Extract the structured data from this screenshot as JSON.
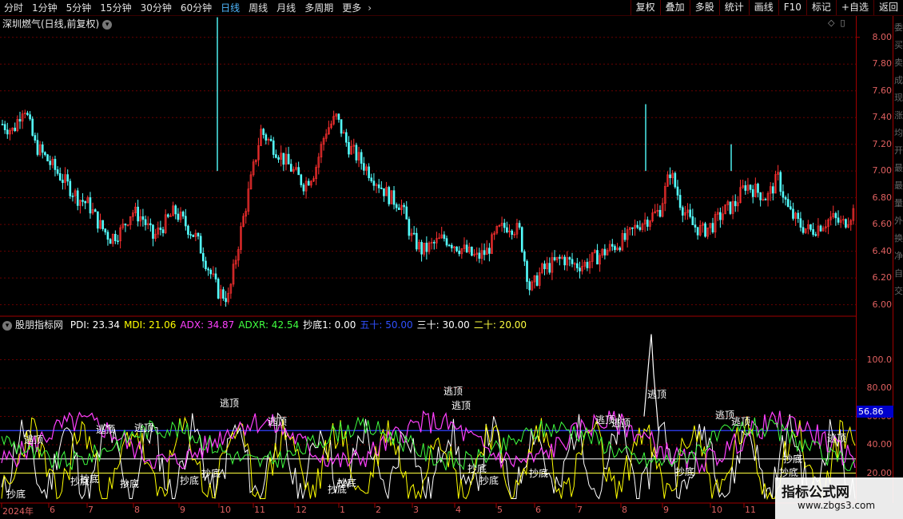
{
  "toolbar": {
    "periods": [
      "分时",
      "1分钟",
      "5分钟",
      "15分钟",
      "30分钟",
      "60分钟",
      "日线",
      "周线",
      "月线",
      "多周期",
      "更多"
    ],
    "active_period": "日线",
    "right_buttons": [
      "复权",
      "叠加",
      "多股",
      "统计",
      "画线",
      "F10",
      "标记",
      "+自选",
      "返回"
    ]
  },
  "price_panel": {
    "title": "深圳燃气(日线,前复权)",
    "y_ticks": [
      "8.00",
      "7.80",
      "7.60",
      "7.40",
      "7.20",
      "7.00",
      "6.80",
      "6.60",
      "6.40",
      "6.20",
      "6.00"
    ]
  },
  "indicator_panel": {
    "name": "股朋指标网",
    "values": [
      {
        "label": "PDI: 23.34",
        "color": "#ffffff"
      },
      {
        "label": "MDI: 21.06",
        "color": "#ffff00"
      },
      {
        "label": "ADX: 34.87",
        "color": "#ff40ff"
      },
      {
        "label": "ADXR: 42.54",
        "color": "#40ff40"
      },
      {
        "label": "抄底1: 0.00",
        "color": "#ffffff"
      },
      {
        "label": "五十: 50.00",
        "color": "#3050ff"
      },
      {
        "label": "三十: 30.00",
        "color": "#ffffff"
      },
      {
        "label": "二十: 20.00",
        "color": "#ffff40"
      }
    ],
    "y_ticks": [
      "100.0",
      "80.00",
      "60.00",
      "40.00",
      "20.00"
    ],
    "current_value": "56.86",
    "signal_escape": "逃顶",
    "signal_bottom": "抄底"
  },
  "x_axis": [
    "2024年",
    "6",
    "7",
    "8",
    "9",
    "10",
    "11",
    "12",
    "1",
    "2",
    "3",
    "4",
    "5",
    "6",
    "7",
    "8",
    "9",
    "10",
    "11"
  ],
  "side_strip": [
    "委",
    "买",
    "卖",
    "成",
    "现",
    "涨",
    "均",
    "开",
    "最",
    "最",
    "量",
    "外",
    "换",
    "净",
    "自",
    "交"
  ],
  "watermark": {
    "title": "指标公式网",
    "url": "www.zbgs3.com"
  },
  "chart_data": {
    "type": "candlestick",
    "title": "深圳燃气(日线,前复权)",
    "ylim": [
      5.95,
      8.1
    ],
    "x_month_labels": [
      "2024年",
      "6",
      "7",
      "8",
      "9",
      "10",
      "11",
      "12",
      "1",
      "2",
      "3",
      "4",
      "5",
      "6",
      "7",
      "8",
      "9",
      "10",
      "11"
    ],
    "close_series": [
      7.35,
      7.3,
      7.5,
      7.2,
      7.1,
      7.0,
      6.9,
      6.8,
      6.75,
      6.6,
      6.5,
      6.55,
      6.7,
      6.65,
      6.5,
      6.6,
      6.7,
      6.6,
      6.5,
      6.3,
      6.1,
      6.05,
      6.5,
      6.9,
      7.3,
      7.2,
      7.1,
      7.0,
      6.9,
      7.0,
      7.3,
      7.4,
      7.2,
      7.1,
      7.0,
      6.9,
      6.8,
      6.75,
      6.5,
      6.4,
      6.45,
      6.5,
      6.45,
      6.4,
      6.35,
      6.4,
      6.55,
      6.6,
      6.55,
      6.1,
      6.25,
      6.3,
      6.35,
      6.3,
      6.3,
      6.35,
      6.4,
      6.45,
      6.5,
      6.6,
      6.65,
      6.7,
      7.0,
      6.75,
      6.6,
      6.55,
      6.6,
      6.7,
      6.75,
      6.9,
      6.85,
      6.8,
      6.95,
      6.7,
      6.6,
      6.55,
      6.6,
      6.65,
      6.6,
      6.7
    ]
  },
  "indicator_data": {
    "type": "line",
    "ylim": [
      0,
      120
    ],
    "reference_lines": [
      {
        "name": "五十",
        "value": 50
      },
      {
        "name": "三十",
        "value": 30
      },
      {
        "name": "二十",
        "value": 20
      }
    ]
  }
}
